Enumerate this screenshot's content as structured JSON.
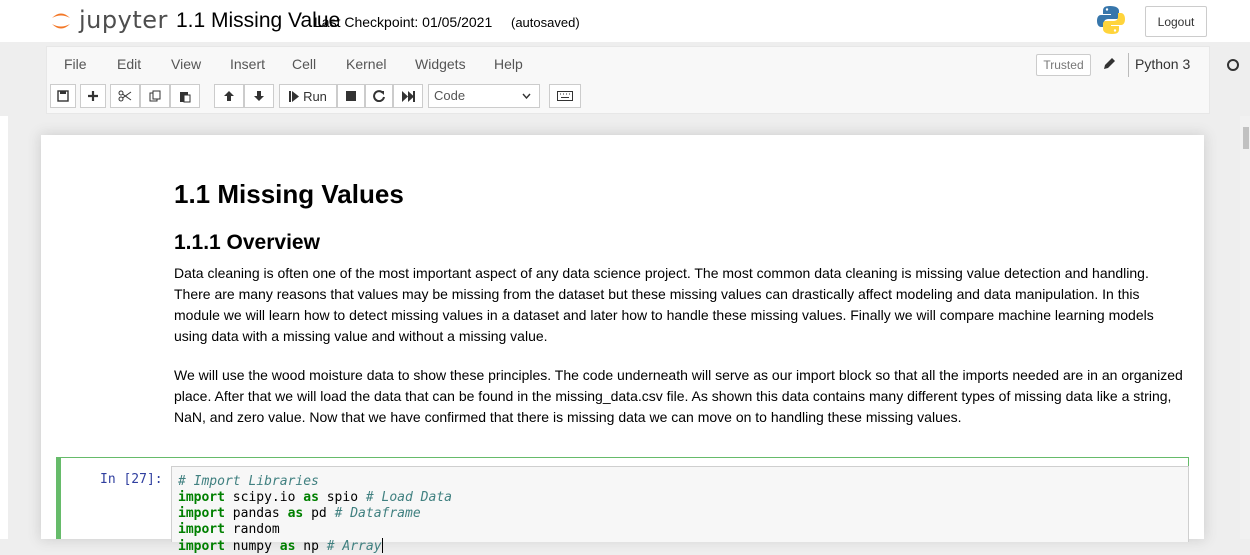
{
  "header": {
    "logo_text": "jupyter",
    "notebook_name": "1.1 Missing Value",
    "checkpoint": "Last Checkpoint: 01/05/2021",
    "autosave": "(autosaved)",
    "logout_label": "Logout"
  },
  "menubar": {
    "items": [
      "File",
      "Edit",
      "View",
      "Insert",
      "Cell",
      "Kernel",
      "Widgets",
      "Help"
    ],
    "trusted_label": "Trusted",
    "kernel_name": "Python 3"
  },
  "toolbar": {
    "run_label": "Run",
    "cell_type": "Code"
  },
  "notebook": {
    "title": "1.1 Missing Values",
    "subtitle": "1.1.1 Overview",
    "paragraph1": "Data cleaning is often one of the most important aspect of any data science project. The most common data cleaning is missing value detection and handling. There are many reasons that values may be missing from the dataset but these missing values can drastically affect modeling and data manipulation. In this module we will learn how to detect missing values in a dataset and later how to handle these missing values. Finally we will compare machine learning models using data with a missing value and without a missing value.",
    "paragraph2": "We will use the wood moisture data to show these principles. The code underneath will serve as our import block so that all the imports needed are in an organized place. After that we will load the data that can be found in the missing_data.csv file. As shown this data contains many different types of missing data like a string, NaN, and zero value. Now that we have confirmed that there is missing data we can move on to handling these missing values.",
    "code_cell": {
      "prompt": "In [27]:",
      "lines": [
        {
          "kw": "",
          "code": "",
          "comment": "# Import Libraries"
        },
        {
          "kw": "import",
          "code": " scipy.io ",
          "kw2": "as",
          "code2": " spio ",
          "comment": "# Load Data"
        },
        {
          "kw": "import",
          "code": " pandas ",
          "kw2": "as",
          "code2": " pd ",
          "comment": "# Dataframe"
        },
        {
          "kw": "import",
          "code": " random",
          "kw2": "",
          "code2": "",
          "comment": ""
        },
        {
          "kw": "import",
          "code": " numpy ",
          "kw2": "as",
          "code2": " np ",
          "comment": "# Array"
        }
      ]
    }
  },
  "colors": {
    "active_cell_border": "#66bb6a",
    "prompt": "#303f9f",
    "keyword": "#008000",
    "comment": "#408080"
  }
}
